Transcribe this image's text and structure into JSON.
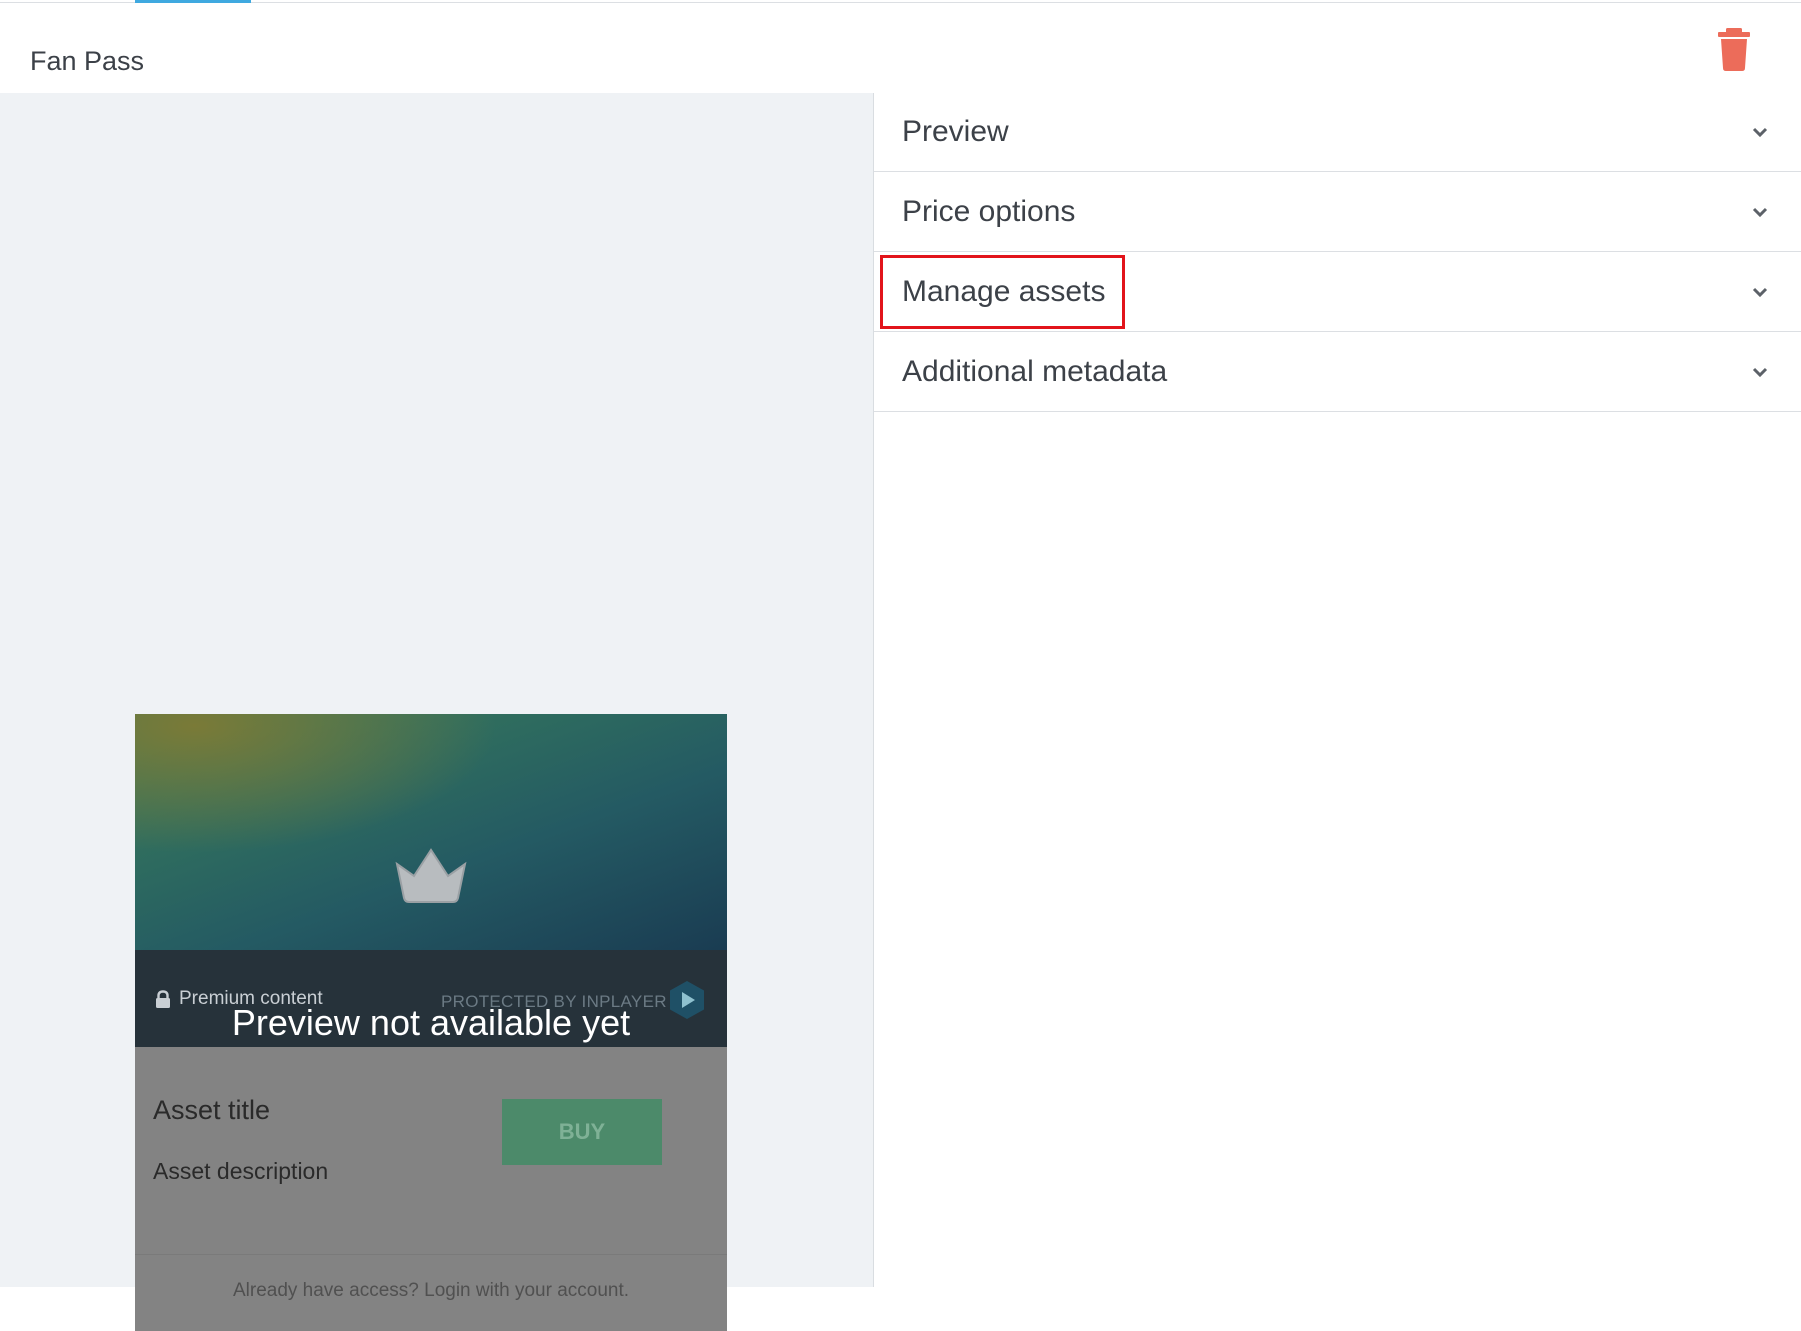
{
  "header": {
    "title": "Fan Pass",
    "delete_icon": "trash-icon",
    "delete_color": "#ec6c5a",
    "active_tab_color": "#3fa9e0"
  },
  "accordion": {
    "sections": [
      {
        "label": "Preview"
      },
      {
        "label": "Price options"
      },
      {
        "label": "Manage assets",
        "highlighted": true
      },
      {
        "label": "Additional metadata"
      }
    ],
    "chevron_icon": "chevron-down-icon",
    "highlight_color": "#e2141b"
  },
  "preview_card": {
    "crown_icon": "crown-icon",
    "premium_label": "Premium content",
    "lock_icon": "lock-icon",
    "protected_label": "PROTECTED BY INPLAYER",
    "overlay_text": "Preview not available yet",
    "asset_title": "Asset title",
    "asset_description": "Asset description",
    "buy_label": "BUY",
    "login_text": "Already have access? Login with your account."
  }
}
